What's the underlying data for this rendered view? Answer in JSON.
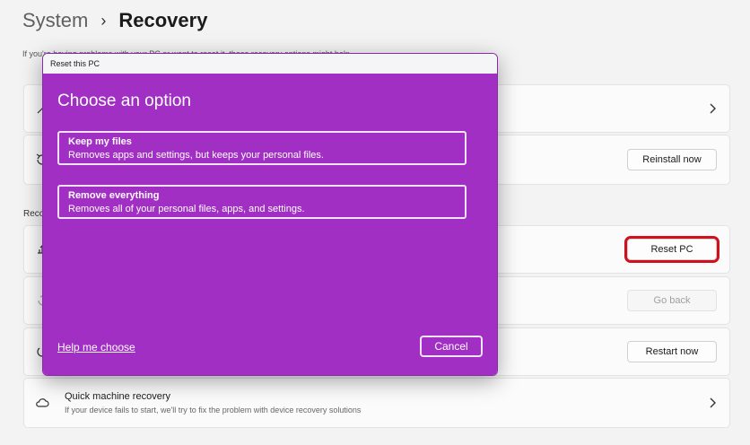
{
  "breadcrumb": {
    "parent": "System",
    "separator": "›",
    "current": "Recovery"
  },
  "page_description": "If you're having problems with your PC or want to reset it, these recovery options might help.",
  "section_label": "Recovery options",
  "cards": {
    "fix_problems": {
      "chevron": "›"
    },
    "reinstall": {
      "button_label": "Reinstall now"
    },
    "reset": {
      "button_label": "Reset PC"
    },
    "go_back": {
      "button_label": "Go back"
    },
    "advanced_startup": {
      "button_label": "Restart now"
    },
    "quick_recovery": {
      "title": "Quick machine recovery",
      "subtitle": "If your device fails to start, we'll try to fix the problem with device recovery solutions",
      "chevron": "›"
    }
  },
  "dialog": {
    "window_title": "Reset this PC",
    "heading": "Choose an option",
    "options": [
      {
        "title": "Keep my files",
        "description": "Removes apps and settings, but keeps your personal files."
      },
      {
        "title": "Remove everything",
        "description": "Removes all of your personal files, apps, and settings."
      }
    ],
    "help_link": "Help me choose",
    "cancel_label": "Cancel"
  },
  "colors": {
    "dialog_background": "#a22fc4",
    "highlight_outline": "#d0101c"
  },
  "icons": [
    "wrench-icon",
    "reinstall-icon",
    "reset-pc-icon",
    "go-back-icon",
    "advanced-startup-icon",
    "cloud-icon",
    "chevron-right-icon"
  ]
}
